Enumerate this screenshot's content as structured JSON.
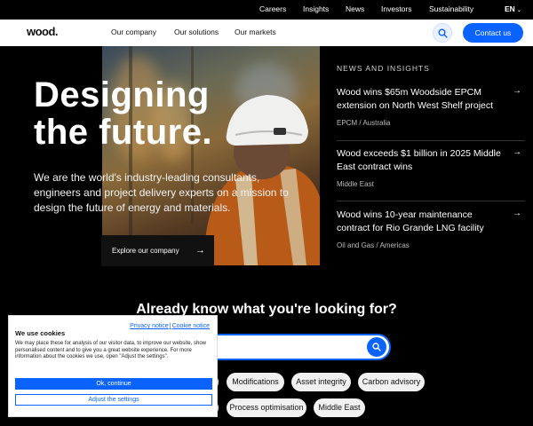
{
  "utility_nav": [
    "Careers",
    "Insights",
    "News",
    "Investors",
    "Sustainability"
  ],
  "language": {
    "label": "EN",
    "chevron": "chevron-down-icon"
  },
  "header": {
    "logo": "wood.",
    "nav": [
      "Our company",
      "Our solutions",
      "Our markets"
    ],
    "search_icon": "search-icon",
    "contact_label": "Contact us"
  },
  "hero": {
    "title_line1": "Designing",
    "title_line2": "the future.",
    "text": "We are the world's industry-leading consultants, engineers and project delivery experts on a mission to design the future of energy and materials.",
    "cta_label": "Explore our company",
    "cta_icon": "arrow-right-icon"
  },
  "news": {
    "heading": "NEWS AND INSIGHTS",
    "items": [
      {
        "title": "Wood wins $65m Woodside EPCM extension on North West Shelf project",
        "tag": "EPCM / Australia"
      },
      {
        "title": "Wood exceeds $1 billion in 2025 Middle East contract wins",
        "tag": "Middle East"
      },
      {
        "title": "Wood wins 10-year maintenance contract for Rio Grande LNG facility",
        "tag": "Oil and Gas / Americas"
      }
    ],
    "arrow_icon": "arrow-right-icon"
  },
  "lookup": {
    "title": "Already know what you're looking for?",
    "search_placeholder": "",
    "chips": [
      "Modifications",
      "Asset integrity",
      "Carbon advisory",
      "Process optimisation",
      "Middle East"
    ]
  },
  "cookie_banner": {
    "privacy_link": "Privacy notice",
    "separator": "|",
    "cookie_link": "Cookie notice",
    "title": "We use cookies",
    "body": "We may place these for analysis of our visitor data, to improve our website, show personalised content and to give you a great website experience. For more information about the cookies we use, open \"Adjust the settings\".",
    "ok_label": "Ok, continue",
    "adjust_label": "Adjust the settings"
  },
  "colors": {
    "accent": "#0a63ff",
    "background": "#000000",
    "chip": "#f1f1f1"
  }
}
